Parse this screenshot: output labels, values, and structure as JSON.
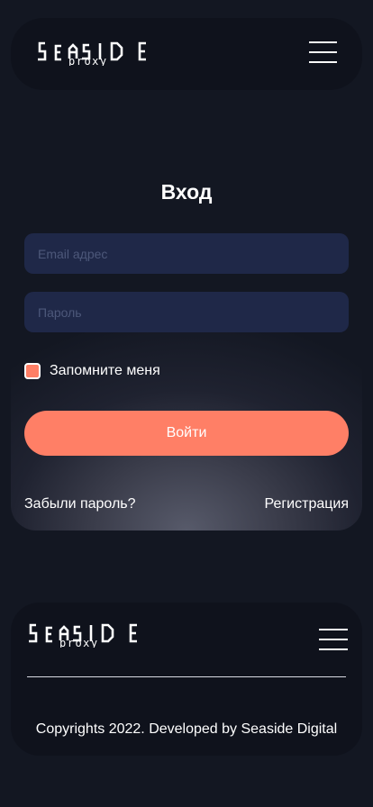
{
  "brand": {
    "logo_main": "SEASIDE",
    "logo_sub": "proxy"
  },
  "login": {
    "title": "Вход",
    "email_placeholder": "Email адрес",
    "password_placeholder": "Пароль",
    "remember_label": "Запомните меня",
    "remember_checked": true,
    "submit_label": "Войти",
    "forgot_link": "Забыли пароль?",
    "register_link": "Регистрация"
  },
  "footer": {
    "copyright": "Copyrights 2022. Developed by Seaside Digital"
  },
  "icons": {
    "menu": "hamburger-menu-icon"
  },
  "colors": {
    "background": "#131722",
    "panel": "#0f121c",
    "input": "#1f2848",
    "accent": "#ff7f66",
    "text": "#ffffff"
  }
}
